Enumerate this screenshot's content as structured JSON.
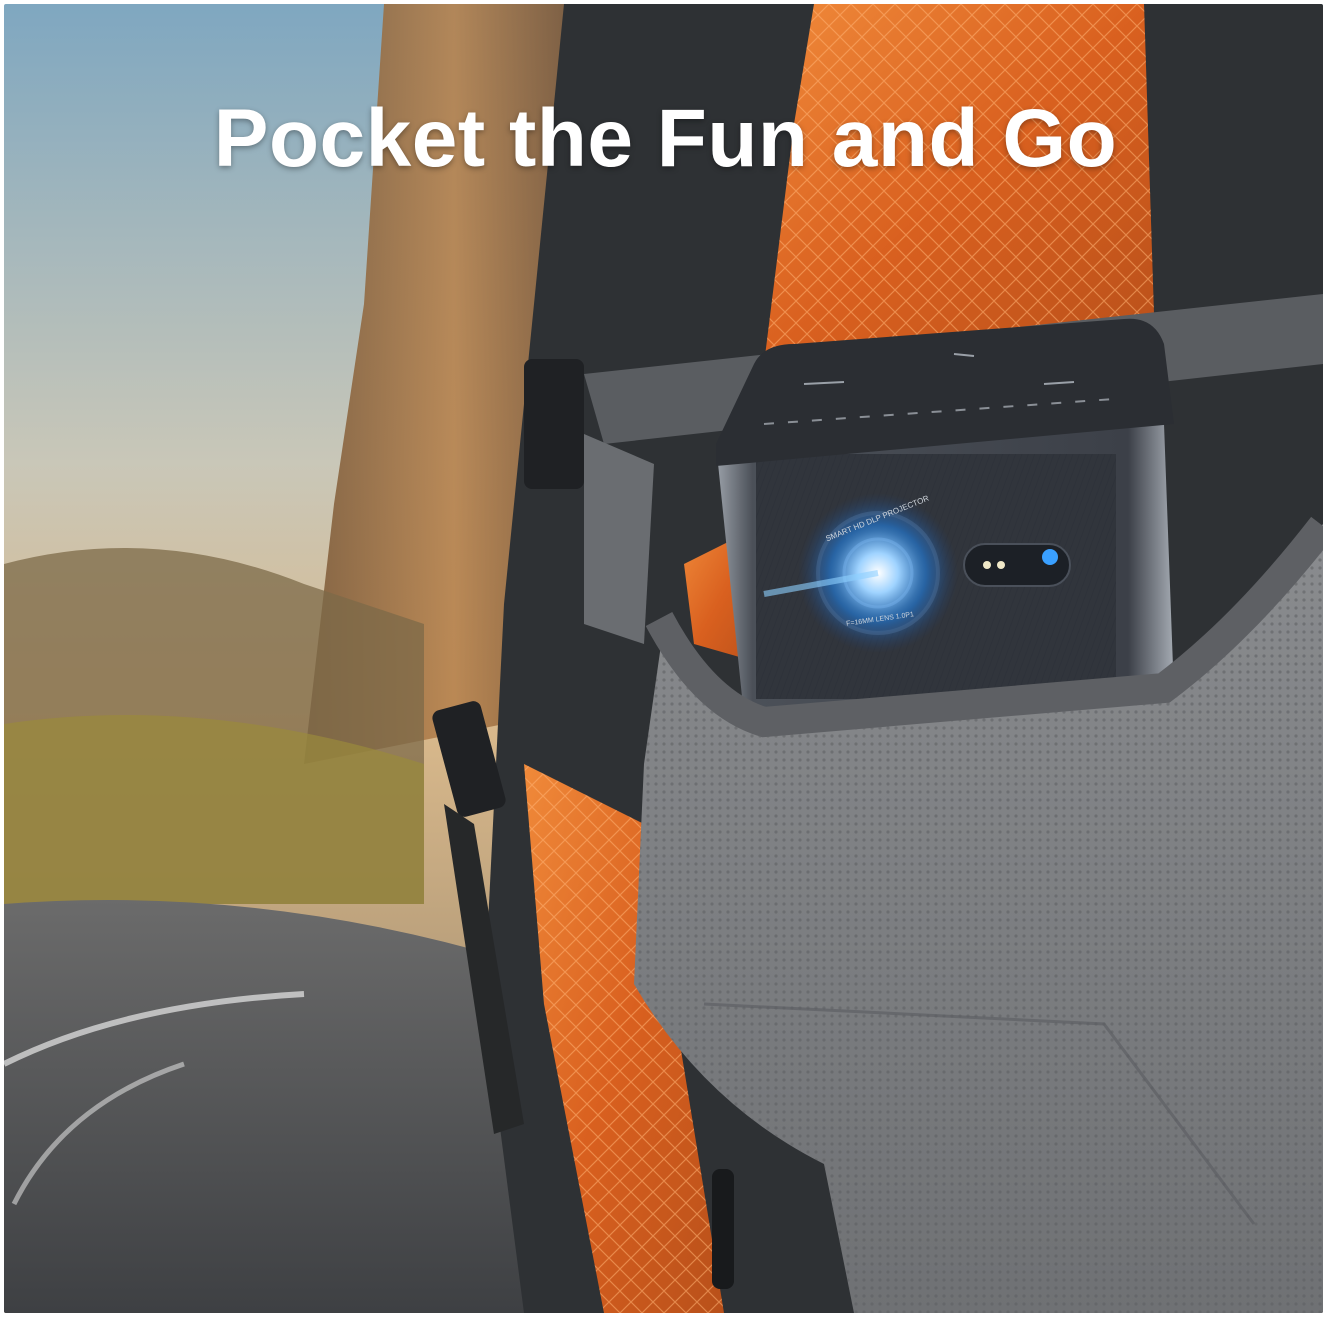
{
  "headline": "Pocket the Fun and Go",
  "projector": {
    "lens_ring_top": "SMART HD DLP PROJECTOR",
    "lens_ring_bottom": "F=16MM LENS 1.0P1"
  },
  "colors": {
    "backpack_orange": "#e8702a",
    "mesh_gray": "#7b7d80",
    "strap_dark": "#2e3134",
    "projector_body": "#3b3f46",
    "sky": "#8fb0c4",
    "rock": "#b07a45",
    "road": "#5c5f63",
    "lens_glow": "#3aa0ff"
  }
}
